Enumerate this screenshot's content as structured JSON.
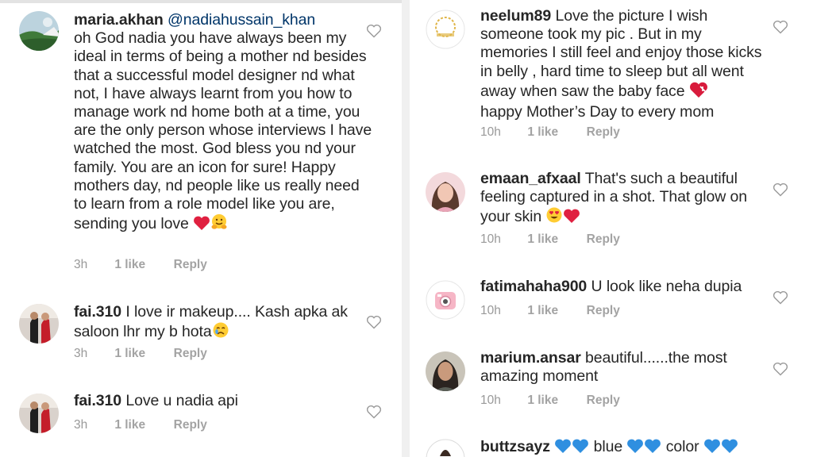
{
  "colors": {
    "text": "#262626",
    "muted": "#999999",
    "mention": "#003569",
    "heart": "#e02040",
    "emoji": "#2f8fe0"
  },
  "comments_left": [
    {
      "username": "maria.akhan",
      "mention": "@nadiahussain_khan",
      "text": "oh God nadia you have always been my ideal in terms of being a mother nd besides that a successful model designer nd what not, I have always learnt from you how to manage work nd home both at a time, you are the only person whose interviews I have watched the most. God bless you nd your family. You are an icon for sure! Happy mothers day, nd people like us really need to learn from a role model like you are, sending you love",
      "emojis": [
        "red-heart",
        "hugging-face"
      ],
      "time": "3h",
      "likes": "1 like",
      "reply": "Reply",
      "avatar": "landscape-avatar"
    },
    {
      "username": "fai.310",
      "text": "I love ir makeup.... Kash apka ak saloon lhr my b hota",
      "emojis": [
        "crying-face"
      ],
      "time": "3h",
      "likes": "1 like",
      "reply": "Reply",
      "avatar": "couple-avatar"
    },
    {
      "username": "fai.310",
      "text": "Love u nadia api",
      "emojis": [],
      "time": "3h",
      "likes": "1 like",
      "reply": "Reply",
      "avatar": "couple-avatar"
    }
  ],
  "comments_right": [
    {
      "username": "neelum89",
      "text": "Love the picture I wish someone took my pic . But in my memories I still feel and enjoy those kicks in belly , hard time to sleep but all went away when saw the  baby face",
      "text2": "happy Mother’s Day to every mom",
      "emojis": [
        "mending-heart"
      ],
      "time": "10h",
      "likes": "1 like",
      "reply": "Reply",
      "avatar": "wreath-logo-avatar"
    },
    {
      "username": "emaan_afxaal",
      "text": "That's such a beautiful feeling captured in a shot. That glow on your skin",
      "emojis": [
        "heart-eyes-face",
        "red-heart"
      ],
      "time": "10h",
      "likes": "1 like",
      "reply": "Reply",
      "avatar": "girl-avatar"
    },
    {
      "username": "fatimahaha900",
      "text": "U look like neha dupia",
      "emojis": [],
      "time": "10h",
      "likes": "1 like",
      "reply": "Reply",
      "avatar": "camera-avatar"
    },
    {
      "username": "marium.ansar",
      "text": "beautiful......the most amazing moment",
      "emojis": [],
      "time": "10h",
      "likes": "1 like",
      "reply": "Reply",
      "avatar": "woman-avatar"
    },
    {
      "username": "buttzsayz",
      "text_parts": [
        "blue",
        "color"
      ],
      "emojis": [
        "blue-heart",
        "blue-heart",
        "blue-heart",
        "blue-heart",
        "blue-heart",
        "blue-heart"
      ],
      "avatar": "partial-avatar"
    }
  ]
}
